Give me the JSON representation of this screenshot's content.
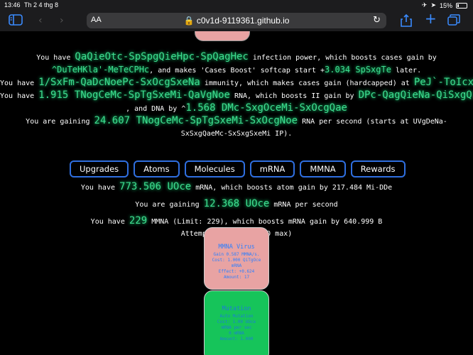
{
  "status_bar": {
    "time": "13:46",
    "date": "Th 2 4 thg 8",
    "battery": "15%"
  },
  "safari": {
    "text_size_label": "AA",
    "url": "c0v1d-9119361.github.io"
  },
  "stats": {
    "infection": {
      "prefix": "You have",
      "value": "QaQieOtc-SpSpgQieHpc-SpQagHec",
      "mid1": "infection power, which boosts cases gain by",
      "boost": "^DuTeHKla'-MeTeCPHc",
      "mid2": ", and makes 'Cases Boost' softcap start +",
      "softcap": "3.034 SpSxgTe",
      "suffix": "later."
    },
    "immunity": {
      "prefix": "You have",
      "value": "1/SxFm-QaDcNoePc-SxOcgSxeNa",
      "mid": "immunity, which makes cases gain (hardcapped) at",
      "cap": "PeJ`-ToIcxNaL`-PoZkeN"
    },
    "rna": {
      "prefix": "You have",
      "value": "1.915 TNogCeMc-SpTgSxeMi-QaVgNoe",
      "mid1": "RNA, which boosts II gain by",
      "boost": "DPc-QagQieNa-QiSxgQieMc",
      "mid2": ", and DNA by ^",
      "dna": "1.568 DMc-SxgOceMi-SxOcgQae"
    },
    "rna_rate": {
      "prefix": "You are gaining",
      "value": "24.607 TNogCeMc-SpTgSxeMi-SxOcgNoe",
      "mid": "RNA per second (starts at UVgDeNa-",
      "suffix": "SxSxgQaeMc-SxSxgSxeMi IP)."
    }
  },
  "tabs": [
    "Upgrades",
    "Atoms",
    "Molecules",
    "mRNA",
    "MMNA",
    "Rewards"
  ],
  "mrna": {
    "have_prefix": "You have",
    "have_value": "773.506 UOce",
    "have_suffix": "mRNA, which boosts atom gain by 217.484 Mi-DDe",
    "gain_prefix": "You are gaining",
    "gain_value": "12.368 UOce",
    "gain_suffix": "mRNA per second",
    "mmna_prefix": "You have",
    "mmna_value": "229",
    "mmna_suffix": "MMNA (Limit: 229), which boosts mRNA gain by 640.999 B",
    "attempt": "Attempt amount:1x (10 max)"
  },
  "cards": {
    "mmna_virus": {
      "title": "MMNA Virus",
      "line1": "Gain 0.587 MMNA/s.",
      "line2": "Cost: 1.000 QiTgOce",
      "line3": "mRNA",
      "line4": "Effect: +0.624",
      "line5": "Amount: 17"
    },
    "mutation": {
      "title": "Mutation",
      "line1": "Auto Mutation",
      "line2": "Cost: 1.00 UOce",
      "line3": "mRNA per sec",
      "line4": "0 mRNA",
      "line5": "Amount: 1.000"
    }
  },
  "colors": {
    "glow_green": "#3edc8f",
    "tab_border": "#2f6fe0",
    "safari_blue": "#3a8bff",
    "card_pink": "#e8a3a3",
    "card_green": "#16c45a"
  }
}
